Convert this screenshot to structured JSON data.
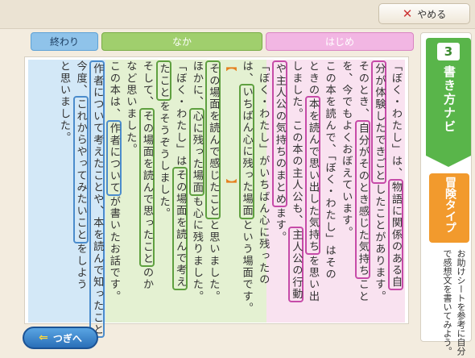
{
  "header": {
    "quit_label": "やめる",
    "quit_icon": "close-x-icon"
  },
  "sections": {
    "end": "終わり",
    "middle": "なか",
    "beginning": "はじめ"
  },
  "sheet": {
    "columns": [
      {
        "id": "c1",
        "parts": [
          {
            "t": "「ぼく・わたし」は、"
          },
          {
            "t": "物語に関係のある自",
            "hl": "mag"
          }
        ]
      },
      {
        "id": "c2",
        "parts": [
          {
            "t": "分が体験したできごと",
            "hl": "mag"
          },
          {
            "t": "したことがあります。"
          }
        ]
      },
      {
        "id": "c3",
        "parts": [
          {
            "t": "そのとき、"
          },
          {
            "t": "自分がそのとき感じた気持ち",
            "hl": "mag"
          },
          {
            "t": "こと"
          }
        ]
      },
      {
        "id": "c4",
        "parts": [
          {
            "t": "を、今でもよくおぼえています。"
          }
        ]
      },
      {
        "id": "c5",
        "parts": [
          {
            "t": "この本を読んで、「ぼく・わたし」はその"
          }
        ]
      },
      {
        "id": "c6",
        "parts": [
          {
            "t": "ときの"
          },
          {
            "t": "本を読んで思い出した気持ち",
            "hl": "mag"
          },
          {
            "t": "を思い出"
          }
        ]
      },
      {
        "id": "c7",
        "parts": [
          {
            "t": "しました。この本の主人公も、"
          },
          {
            "t": "主人公の行動",
            "hl": "mag"
          }
        ]
      },
      {
        "id": "c8",
        "parts": [
          {
            "t": "や主人公の気持ちのまとめ",
            "hl": "mag"
          },
          {
            "t": "ます。"
          }
        ]
      },
      {
        "id": "c9",
        "parts": [
          {
            "t": "「ぼく・わたし」がいちばん心に残ったの"
          }
        ]
      },
      {
        "id": "c10",
        "parts": [
          {
            "t": "は、"
          },
          {
            "t": "いちばん心に残った場面",
            "hl": "green"
          },
          {
            "t": "という場面です。"
          }
        ]
      },
      {
        "id": "c11",
        "parts": [
          {
            "t": "【",
            "hl": "bracket"
          },
          {
            "t": "　　　　　　　　　"
          },
          {
            "t": "】",
            "hl": "bracket"
          }
        ]
      },
      {
        "id": "c12",
        "parts": [
          {
            "t": "その場面を読んで感じたこと",
            "hl": "green"
          },
          {
            "t": "と思いました。"
          }
        ]
      },
      {
        "id": "c13",
        "parts": [
          {
            "t": "ほかに、"
          },
          {
            "t": "心に残った場面",
            "hl": "green"
          },
          {
            "t": "も心に残りました。"
          }
        ]
      },
      {
        "id": "c14",
        "parts": [
          {
            "t": "「ぼく・わたし」は"
          },
          {
            "t": "その場面を読んで考え",
            "hl": "green"
          }
        ]
      },
      {
        "id": "c15",
        "parts": [
          {
            "t": "たこと",
            "hl": "green"
          },
          {
            "t": "をそうぞうしました。"
          }
        ]
      },
      {
        "id": "c16",
        "parts": [
          {
            "t": "そして、"
          },
          {
            "t": "その場面を読んで思ったこと",
            "hl": "green"
          },
          {
            "t": "のか"
          }
        ]
      },
      {
        "id": "c17",
        "parts": [
          {
            "t": "など思いました。"
          }
        ]
      },
      {
        "id": "c18",
        "parts": [
          {
            "t": "この本は、"
          },
          {
            "t": "作者について",
            "hl": "blue"
          },
          {
            "t": "が書いたお話です。"
          }
        ]
      },
      {
        "id": "c19",
        "parts": [
          {
            "t": "作者について考えたことや、本を読んで知ったこと",
            "hl": "blue"
          }
        ]
      },
      {
        "id": "c20",
        "parts": [
          {
            "t": "今度、"
          },
          {
            "t": "これからやってみたいこと",
            "hl": "blue"
          },
          {
            "t": "をしよう"
          }
        ]
      },
      {
        "id": "c21",
        "parts": [
          {
            "t": "と思いました。"
          }
        ]
      }
    ]
  },
  "sidebar": {
    "step_number": "3",
    "title": "書き方ナビ",
    "type_label": "冒険タイプ",
    "instruction_line1": "お助けシートを参考に自分",
    "instruction_line2": "で感想文を書いてみよう。"
  },
  "footer": {
    "next_label": "つぎへ"
  },
  "colors": {
    "blue": "#4b8ccc",
    "green": "#5fa040",
    "magenta": "#c64ba8",
    "accent_orange": "#f29a2d",
    "nav_green": "#59b54a"
  }
}
